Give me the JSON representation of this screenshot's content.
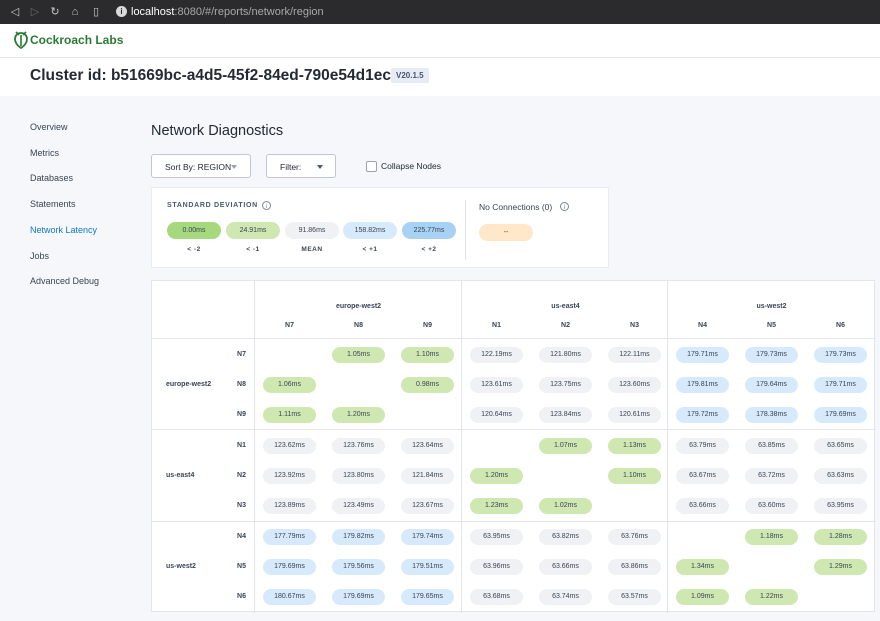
{
  "browser": {
    "url_host": "localhost",
    "url_path": ":8080/#/reports/network/region"
  },
  "brand": {
    "name": "Cockroach Labs",
    "color": "#2b7a35"
  },
  "header": {
    "cluster": "Cluster id: b51669bc-a4d5-45f2-84ed-790e54d1ec68",
    "version": "V20.1.5"
  },
  "sidebar": {
    "items": [
      {
        "label": "Overview",
        "active": false
      },
      {
        "label": "Metrics",
        "active": false
      },
      {
        "label": "Databases",
        "active": false
      },
      {
        "label": "Statements",
        "active": false
      },
      {
        "label": "Network Latency",
        "active": true
      },
      {
        "label": "Jobs",
        "active": false
      },
      {
        "label": "Advanced Debug",
        "active": false
      }
    ]
  },
  "page": {
    "title": "Network Diagnostics",
    "sort_label": "Sort By: REGION",
    "filter_label": "Filter:",
    "collapse_label": "Collapse Nodes"
  },
  "legend": {
    "title": "STANDARD DEVIATION",
    "chips": [
      {
        "value": "0.00ms",
        "label": "< -2",
        "color": "g2"
      },
      {
        "value": "24.91ms",
        "label": "< -1",
        "color": "g1"
      },
      {
        "value": "91.86ms",
        "label": "MEAN",
        "color": "n"
      },
      {
        "value": "158.82ms",
        "label": "< +1",
        "color": "b1"
      },
      {
        "value": "225.77ms",
        "label": "< +2",
        "color": "b2"
      }
    ],
    "no_connections": "No Connections (0)",
    "no_connections_chip": "--"
  },
  "matrix": {
    "regions": [
      {
        "name": "europe-west2",
        "nodes": [
          "N7",
          "N8",
          "N9"
        ]
      },
      {
        "name": "us-east4",
        "nodes": [
          "N1",
          "N2",
          "N3"
        ]
      },
      {
        "name": "us-west2",
        "nodes": [
          "N4",
          "N5",
          "N6"
        ]
      }
    ],
    "rows": [
      [
        "",
        "1.05ms",
        "1.10ms",
        "122.19ms",
        "121.80ms",
        "122.11ms",
        "179.71ms",
        "179.73ms",
        "179.73ms"
      ],
      [
        "1.06ms",
        "",
        "0.98ms",
        "123.61ms",
        "123.75ms",
        "123.60ms",
        "179.81ms",
        "179.64ms",
        "179.71ms"
      ],
      [
        "1.11ms",
        "1.20ms",
        "",
        "120.64ms",
        "123.84ms",
        "120.61ms",
        "179.72ms",
        "178.38ms",
        "179.69ms"
      ],
      [
        "123.62ms",
        "123.76ms",
        "123.64ms",
        "",
        "1.07ms",
        "1.13ms",
        "63.79ms",
        "63.85ms",
        "63.65ms"
      ],
      [
        "123.92ms",
        "123.80ms",
        "121.84ms",
        "1.20ms",
        "",
        "1.10ms",
        "63.67ms",
        "63.72ms",
        "63.63ms"
      ],
      [
        "123.89ms",
        "123.49ms",
        "123.67ms",
        "1.23ms",
        "1.02ms",
        "",
        "63.66ms",
        "63.60ms",
        "63.95ms"
      ],
      [
        "177.79ms",
        "179.82ms",
        "179.74ms",
        "63.95ms",
        "63.82ms",
        "63.76ms",
        "",
        "1.18ms",
        "1.28ms"
      ],
      [
        "179.69ms",
        "179.56ms",
        "179.51ms",
        "63.96ms",
        "63.66ms",
        "63.86ms",
        "1.34ms",
        "",
        "1.29ms"
      ],
      [
        "180.67ms",
        "179.69ms",
        "179.65ms",
        "63.68ms",
        "63.74ms",
        "63.57ms",
        "1.09ms",
        "1.22ms",
        ""
      ]
    ]
  },
  "colors": {
    "green": "#cfe8b1",
    "green_strong": "#a6d97d",
    "blue": "#d6eafb",
    "blue_strong": "#a7d2f6",
    "neutral": "#eff1f5",
    "active_link": "#0f77c2"
  }
}
